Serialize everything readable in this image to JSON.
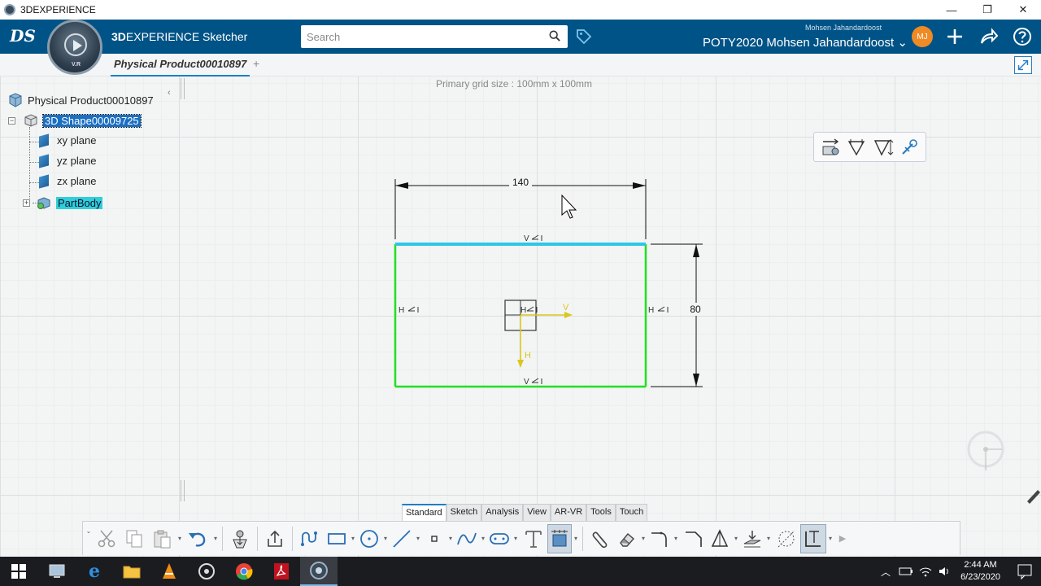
{
  "window": {
    "title": "3DEXPERIENCE",
    "minimize": "—",
    "maximize": "❐",
    "close": "✕"
  },
  "topbar": {
    "brand": "DS",
    "compass_label": "V.R",
    "app_prefix": "3D",
    "app_name": "EXPERIENCE Sketcher",
    "search_placeholder": "Search",
    "user_small": "Mohsen Jahandardoost",
    "user_big": "POTY2020 Mohsen Jahandardoost",
    "avatar_initials": "MJ",
    "colors": {
      "bar": "#005386",
      "accent": "#f08a24"
    }
  },
  "tabs": {
    "active": "Physical Product00010897",
    "add": "+"
  },
  "canvas": {
    "grid_info": "Primary grid size : 100mm x 100mm",
    "collapse": "‹"
  },
  "tree": {
    "root": "Physical Product00010897",
    "shape": "3D Shape00009725",
    "planes": [
      "xy plane",
      "yz plane",
      "zx plane"
    ],
    "body": "PartBody",
    "expander_minus": "−",
    "expander_plus": "+"
  },
  "sketch": {
    "dim_width": "140",
    "dim_height": "80",
    "constraint_v": "V",
    "constraint_h": "H",
    "axis_v": "V",
    "axis_h": "H",
    "colors": {
      "rect": "#22e022",
      "selected": "#2fc6e8",
      "axis": "#d8c81a",
      "dim": "#111111"
    }
  },
  "bottom": {
    "section_tabs": [
      "Standard",
      "Sketch",
      "Analysis",
      "View",
      "AR-VR",
      "Tools",
      "Touch"
    ],
    "active_tab": "Standard"
  },
  "taskbar": {
    "time": "2:44 AM",
    "date": "6/23/2020"
  }
}
